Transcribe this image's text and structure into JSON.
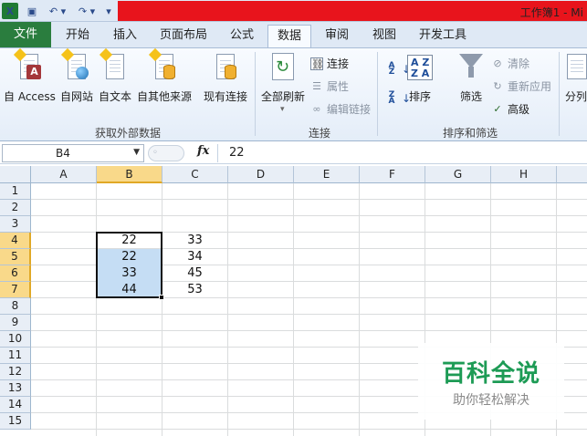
{
  "window": {
    "app_icon": "X",
    "title": "工作簿1 - Mi"
  },
  "qat": {
    "save_icon": "▣",
    "undo_icon": "↶ ▾",
    "redo_icon": "↷ ▾",
    "more_icon": "▾"
  },
  "tabs": {
    "file": "文件",
    "start": "开始",
    "insert": "插入",
    "layout": "页面布局",
    "formula": "公式",
    "data": "数据",
    "review": "审阅",
    "view": "视图",
    "dev": "开发工具"
  },
  "ribbon": {
    "get_external": {
      "access": "自 Access",
      "web": "自网站",
      "text": "自文本",
      "other": "自其他来源",
      "existing": "现有连接",
      "group_label": "获取外部数据"
    },
    "connections": {
      "refresh_all": "全部刷新",
      "connections": "连接",
      "properties": "属性",
      "edit_links": "编辑链接",
      "group_label": "连接"
    },
    "sort_filter": {
      "sort": "排序",
      "filter": "筛选",
      "clear": "清除",
      "reapply": "重新应用",
      "advanced": "高级",
      "group_label": "排序和筛选"
    },
    "tools": {
      "split": "分列"
    }
  },
  "formula_bar": {
    "name_box": "B4",
    "fx": "fx",
    "value": "22"
  },
  "sheet": {
    "columns": [
      "A",
      "B",
      "C",
      "D",
      "E",
      "F",
      "G",
      "H"
    ],
    "rows": [
      "1",
      "2",
      "3",
      "4",
      "5",
      "6",
      "7",
      "8",
      "9",
      "10",
      "11",
      "12",
      "13",
      "14",
      "15"
    ],
    "cells": {
      "B4": "22",
      "B5": "22",
      "B6": "33",
      "B7": "44",
      "C4": "33",
      "C5": "34",
      "C6": "45",
      "C7": "53"
    },
    "selected_cell": "B4",
    "selected_range": "B4:B7"
  },
  "watermark": {
    "main": "百科全说",
    "sub": "助你轻松解决"
  },
  "colors": {
    "file_tab": "#2a7d3e",
    "title_bar_red": "#e8141c",
    "selection_fill": "#c5ddf4",
    "header_highlight": "#f9d98a",
    "watermark_green": "#1d9b55"
  }
}
